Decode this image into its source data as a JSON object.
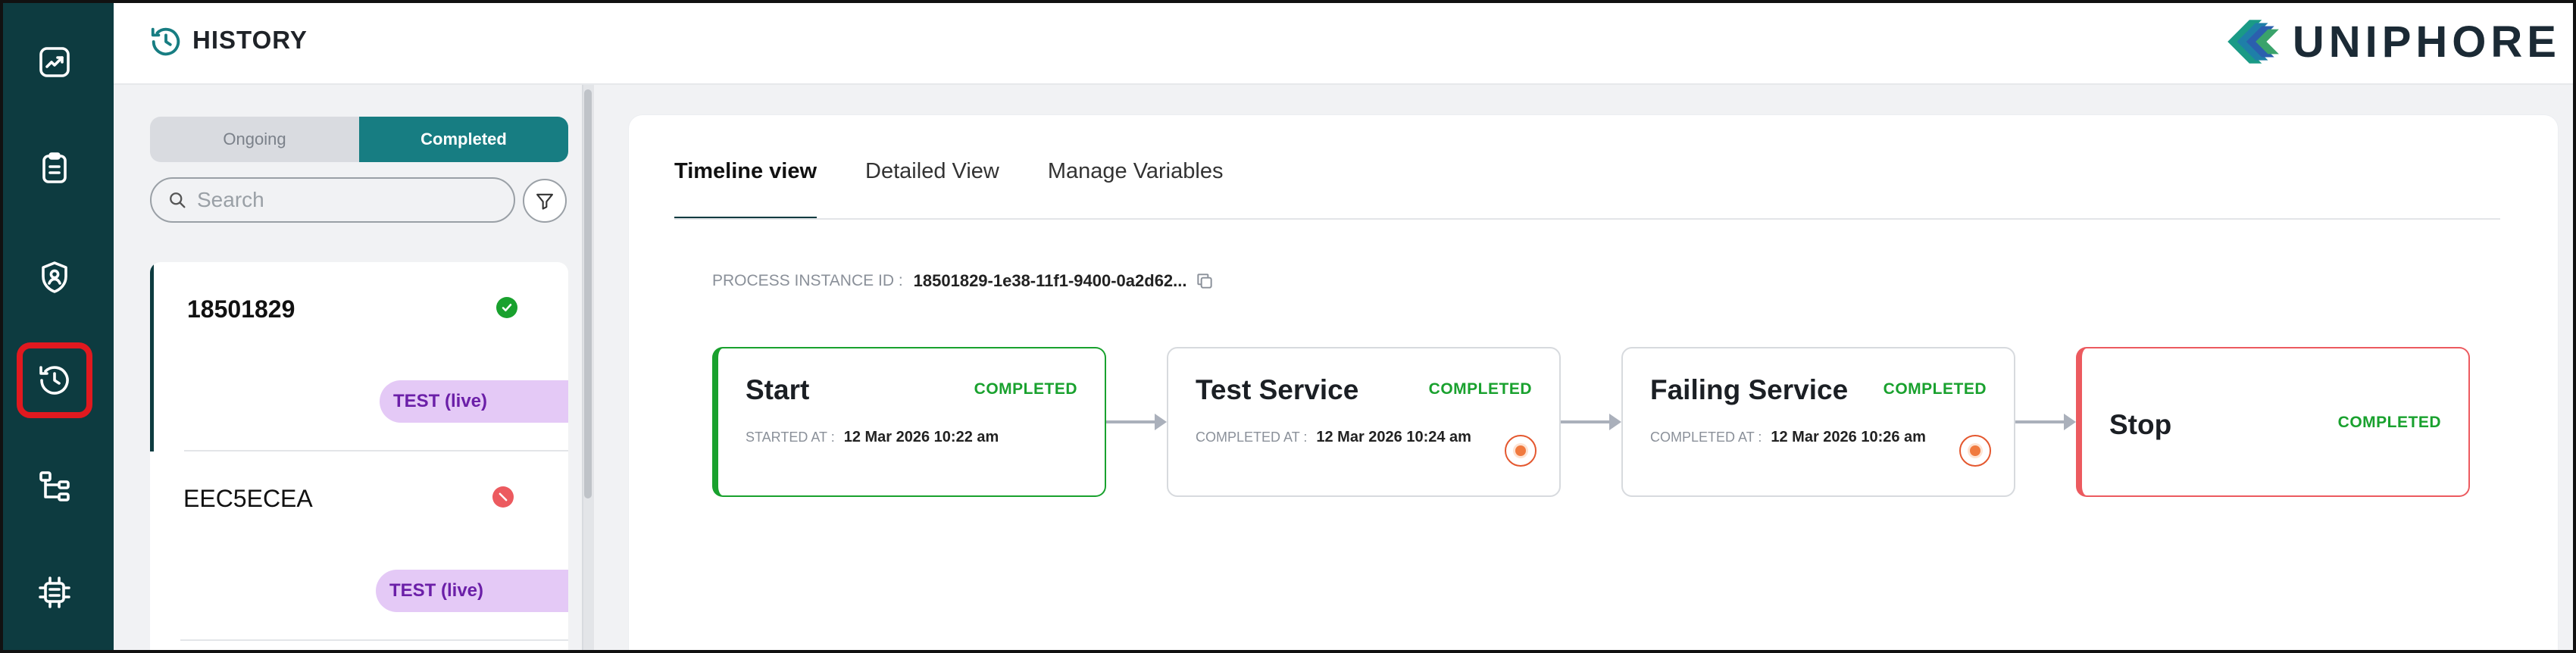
{
  "rail": {
    "items": [
      {
        "name": "analytics",
        "icon": "trend-chart-icon"
      },
      {
        "name": "tasks",
        "icon": "clipboard-icon"
      },
      {
        "name": "security",
        "icon": "shield-user-icon"
      },
      {
        "name": "history",
        "icon": "history-clock-icon",
        "active": true
      },
      {
        "name": "workflows",
        "icon": "tree-structure-icon"
      },
      {
        "name": "integrations",
        "icon": "chip-icon"
      }
    ]
  },
  "header": {
    "title": "HISTORY",
    "brand": "UNIPHORE"
  },
  "list": {
    "segments": {
      "ongoing": "Ongoing",
      "completed": "Completed",
      "active": "completed"
    },
    "search_placeholder": "Search",
    "items": [
      {
        "id": "18501829",
        "status": "success",
        "tag": "TEST (live)"
      },
      {
        "id": "EEC5ECEA",
        "status": "error",
        "tag": "TEST (live)"
      }
    ]
  },
  "tabs": [
    {
      "label": "Timeline view",
      "active": true
    },
    {
      "label": "Detailed View"
    },
    {
      "label": "Manage Variables"
    }
  ],
  "process": {
    "label": "PROCESS INSTANCE ID :",
    "value": "18501829-1e38-11f1-9400-0a2d62..."
  },
  "timeline": [
    {
      "name": "Start",
      "status": "COMPLETED",
      "meta_key": "STARTED AT :",
      "meta_val": "12 Mar 2026 10:22 am"
    },
    {
      "name": "Test Service",
      "status": "COMPLETED",
      "meta_key": "COMPLETED AT :",
      "meta_val": "12 Mar 2026 10:24 am"
    },
    {
      "name": "Failing Service",
      "status": "COMPLETED",
      "meta_key": "COMPLETED AT :",
      "meta_val": "12 Mar 2026 10:26 am"
    },
    {
      "name": "Stop",
      "status": "COMPLETED"
    }
  ],
  "colors": {
    "rail": "#0d3b40",
    "accent": "#177d82",
    "success": "#19a12e",
    "danger": "#ec5a5f",
    "tag_bg": "#e4c9f6",
    "tag_fg": "#6b1fa8"
  }
}
